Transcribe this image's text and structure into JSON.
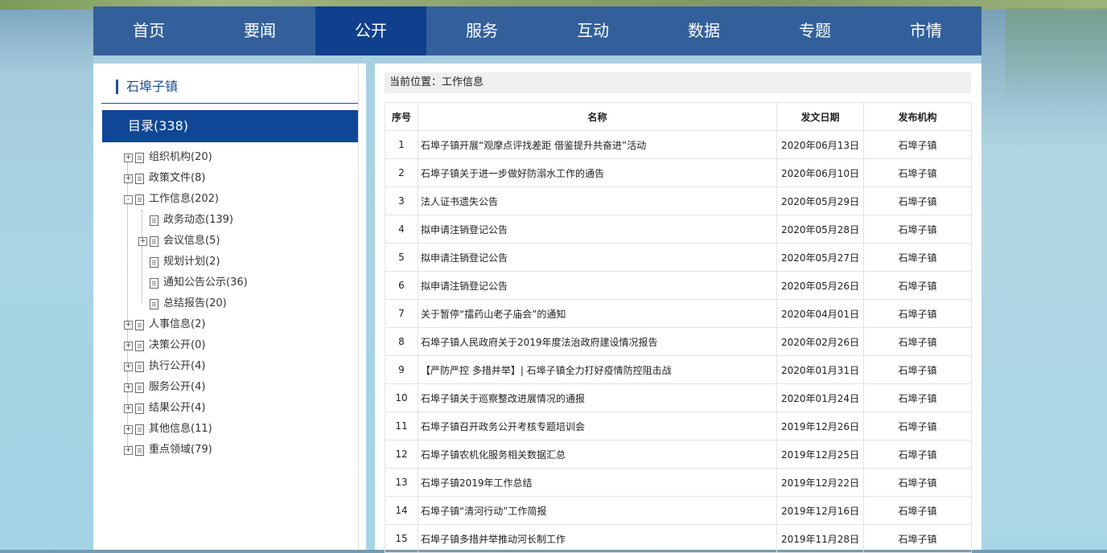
{
  "nav": {
    "items": [
      {
        "label": "首页"
      },
      {
        "label": "要闻"
      },
      {
        "label": "公开"
      },
      {
        "label": "服务"
      },
      {
        "label": "互动"
      },
      {
        "label": "数据"
      },
      {
        "label": "专题"
      },
      {
        "label": "市情"
      }
    ],
    "active": "公开"
  },
  "sidebar": {
    "title": "石埠子镇",
    "catalog": "目录(338)",
    "tree": [
      {
        "label": "组织机构(20)",
        "toggle": "+"
      },
      {
        "label": "政策文件(8)",
        "toggle": "+"
      },
      {
        "label": "工作信息(202)",
        "toggle": "-"
      },
      {
        "label": "政务动态(139)",
        "toggle": ""
      },
      {
        "label": "会议信息(5)",
        "toggle": "+"
      },
      {
        "label": "规划计划(2)",
        "toggle": ""
      },
      {
        "label": "通知公告公示(36)",
        "toggle": ""
      },
      {
        "label": "总结报告(20)",
        "toggle": ""
      },
      {
        "label": "人事信息(2)",
        "toggle": "+"
      },
      {
        "label": "决策公开(0)",
        "toggle": "+"
      },
      {
        "label": "执行公开(4)",
        "toggle": "+"
      },
      {
        "label": "服务公开(4)",
        "toggle": "+"
      },
      {
        "label": "结果公开(4)",
        "toggle": "+"
      },
      {
        "label": "其他信息(11)",
        "toggle": "+"
      },
      {
        "label": "重点领域(79)",
        "toggle": "+"
      }
    ]
  },
  "content": {
    "breadcrumb": "当前位置：工作信息",
    "columns": [
      "序号",
      "名称",
      "发文日期",
      "发布机构"
    ],
    "rows": [
      {
        "no": "1",
        "name": "石埠子镇开展“观摩点评找差距 借鉴提升共奋进”活动",
        "date": "2020年06月13日",
        "org": "石埠子镇"
      },
      {
        "no": "2",
        "name": "石埠子镇关于进一步做好防溺水工作的通告",
        "date": "2020年06月10日",
        "org": "石埠子镇"
      },
      {
        "no": "3",
        "name": "法人证书遗失公告",
        "date": "2020年05月29日",
        "org": "石埠子镇"
      },
      {
        "no": "4",
        "name": "拟申请注销登记公告",
        "date": "2020年05月28日",
        "org": "石埠子镇"
      },
      {
        "no": "5",
        "name": "拟申请注销登记公告",
        "date": "2020年05月27日",
        "org": "石埠子镇"
      },
      {
        "no": "6",
        "name": "拟申请注销登记公告",
        "date": "2020年05月26日",
        "org": "石埠子镇"
      },
      {
        "no": "7",
        "name": "关于暂停“擂药山老子庙会”的通知",
        "date": "2020年04月01日",
        "org": "石埠子镇"
      },
      {
        "no": "8",
        "name": "石埠子镇人民政府关于2019年度法治政府建设情况报告",
        "date": "2020年02月26日",
        "org": "石埠子镇"
      },
      {
        "no": "9",
        "name": "【严防严控 多措并举】| 石埠子镇全力打好疫情防控阻击战",
        "date": "2020年01月31日",
        "org": "石埠子镇"
      },
      {
        "no": "10",
        "name": "石埠子镇关于巡察整改进展情况的通报",
        "date": "2020年01月24日",
        "org": "石埠子镇"
      },
      {
        "no": "11",
        "name": "石埠子镇召开政务公开考核专题培训会",
        "date": "2019年12月26日",
        "org": "石埠子镇"
      },
      {
        "no": "12",
        "name": "石埠子镇农机化服务相关数据汇总",
        "date": "2019年12月25日",
        "org": "石埠子镇"
      },
      {
        "no": "13",
        "name": "石埠子镇2019年工作总结",
        "date": "2019年12月22日",
        "org": "石埠子镇"
      },
      {
        "no": "14",
        "name": "石埠子镇“清河行动”工作简报",
        "date": "2019年12月16日",
        "org": "石埠子镇"
      },
      {
        "no": "15",
        "name": "石埠子镇多措并举推动河长制工作",
        "date": "2019年11月28日",
        "org": "石埠子镇"
      }
    ]
  }
}
